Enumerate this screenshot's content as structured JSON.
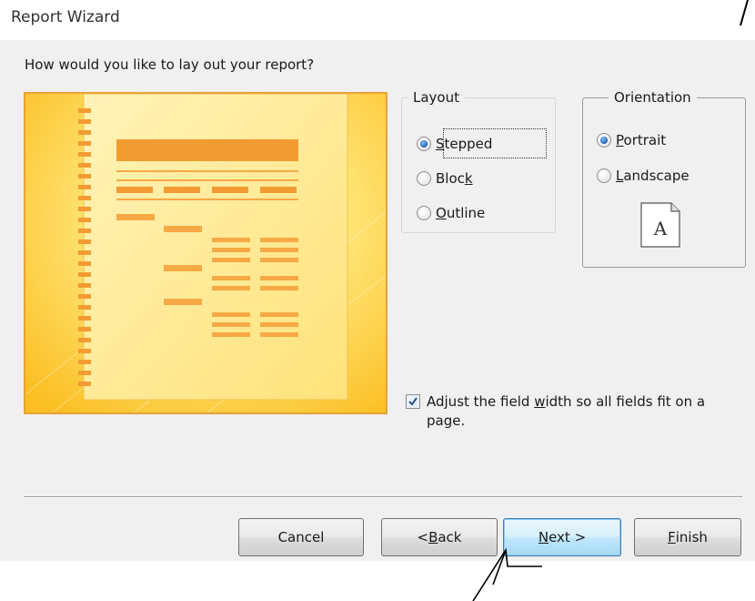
{
  "window": {
    "title": "Report Wizard"
  },
  "prompt": "How would you like to lay out your report?",
  "layout": {
    "legend": "Layout",
    "options": [
      {
        "label": "Stepped",
        "mnemonic_index": 0,
        "checked": true
      },
      {
        "label": "Block",
        "mnemonic_index": 4,
        "checked": false
      },
      {
        "label": "Outline",
        "mnemonic_index": 0,
        "checked": false
      }
    ]
  },
  "orientation": {
    "legend": "Orientation",
    "options": [
      {
        "label": "Portrait",
        "mnemonic_index": 0,
        "checked": true
      },
      {
        "label": "Landscape",
        "mnemonic_index": 0,
        "checked": false
      }
    ],
    "paper_letter": "A"
  },
  "adjust_width": {
    "checked": true,
    "label_before": "Adjust the field ",
    "label_mnemonic": "w",
    "label_after": "idth so all fields fit on a page."
  },
  "buttons": {
    "cancel": "Cancel",
    "back_prefix": "< ",
    "back_mnemonic": "B",
    "back_rest": "ack",
    "next_mnemonic": "N",
    "next_rest": "ext >",
    "finish_mnemonic": "F",
    "finish_rest": "inish"
  },
  "colors": {
    "preview_border": "#e8a238",
    "preview_bg": "#ffd54a",
    "accent_orange": "#f2922b",
    "radio_blue": "#2a6fbf"
  }
}
